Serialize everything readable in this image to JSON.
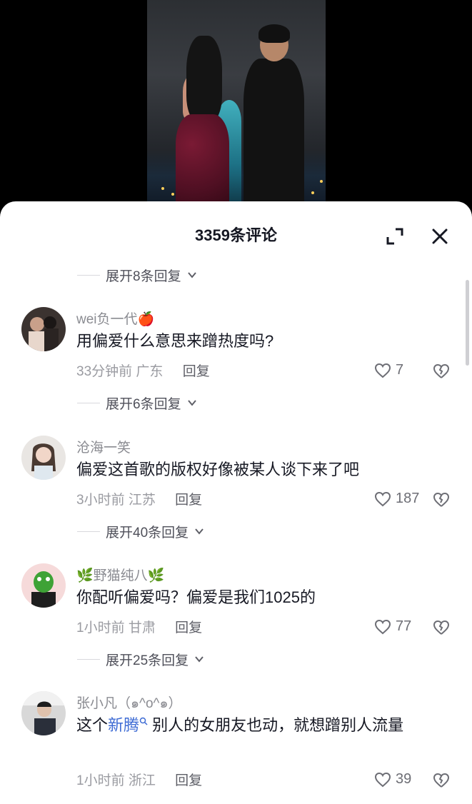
{
  "header": {
    "title": "3359条评论"
  },
  "icons": {
    "expand": "expand-icon",
    "close": "close-icon",
    "like": "heart-outline-icon",
    "dislike": "broken-heart-icon",
    "chevron": "chevron-down-icon"
  },
  "colors": {
    "link": "#3d6bd4",
    "text": "#161823",
    "meta": "#9a9ba1"
  },
  "reply_toggles": [
    {
      "label": "展开8条回复"
    },
    {
      "label": "展开6条回复"
    },
    {
      "label": "展开40条回复"
    },
    {
      "label": "展开25条回复"
    }
  ],
  "comments": [
    {
      "username": "wei负一代🍎",
      "content": "用偏爱什么意思来蹭热度吗?",
      "time": "33分钟前",
      "location": "广东",
      "reply_label": "回复",
      "likes": "7"
    },
    {
      "username": "沧海一笑",
      "content": "偏爱这首歌的版权好像被某人谈下来了吧",
      "time": "3小时前",
      "location": "江苏",
      "reply_label": "回复",
      "likes": "187"
    },
    {
      "username": "🌿野猫纯八🌿",
      "content": "你配听偏爱吗？偏爱是我们1025的",
      "time": "1小时前",
      "location": "甘肃",
      "reply_label": "回复",
      "likes": "77"
    },
    {
      "username": "张小凡（๑^ο^๑）",
      "content_before": "这个",
      "content_link": "新腾",
      "content_after": " 别人的女朋友也动，就想蹭别人流量",
      "time": "1小时前",
      "location": "浙江",
      "reply_label": "回复",
      "likes": "39"
    }
  ]
}
